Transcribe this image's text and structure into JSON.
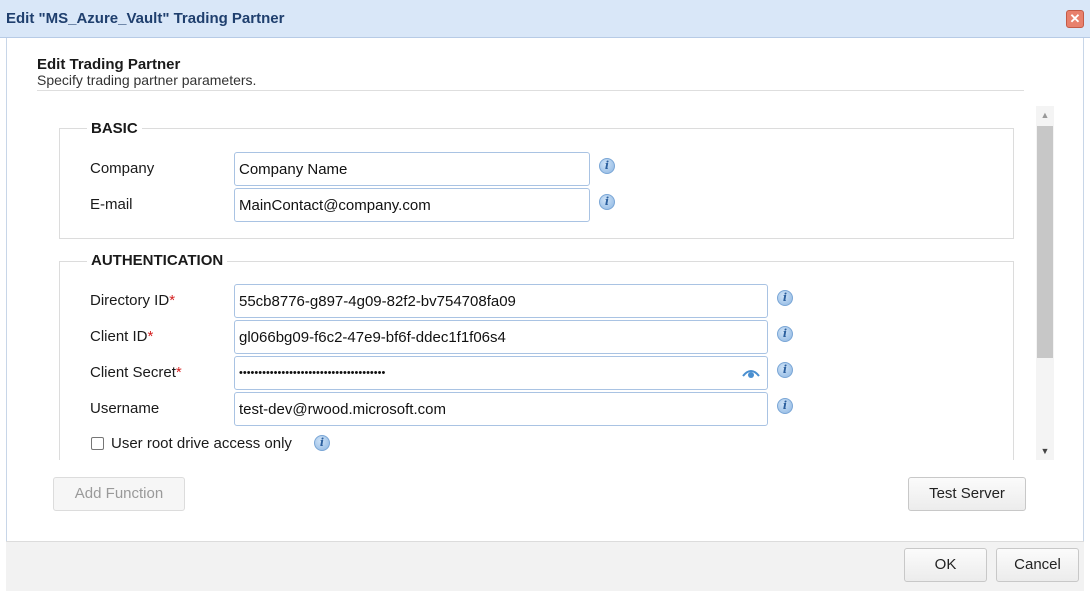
{
  "dialog": {
    "title": "Edit \"MS_Azure_Vault\" Trading Partner",
    "close_symbol": "✕"
  },
  "header": {
    "title": "Edit Trading Partner",
    "subtitle": "Specify trading partner parameters."
  },
  "basic": {
    "legend": "BASIC",
    "company_label": "Company",
    "company_value": "Company Name",
    "email_label": "E-mail",
    "email_value": "MainContact@company.com"
  },
  "authentication": {
    "legend": "AUTHENTICATION",
    "directory_id_label": "Directory ID",
    "directory_id_value": "55cb8776-g897-4g09-82f2-bv754708fa09",
    "client_id_label": "Client ID",
    "client_id_value": "gl066bg09-f6c2-47e9-bf6f-ddec1f1f06s4",
    "client_secret_label": "Client Secret",
    "client_secret_value": "••••••••••••••••••••••••••••••••••••••",
    "username_label": "Username",
    "username_value": "test-dev@rwood.microsoft.com",
    "root_drive_label": "User root drive access only",
    "required_mark": "*"
  },
  "actions": {
    "add_function": "Add Function",
    "test_server": "Test Server",
    "ok": "OK",
    "cancel": "Cancel"
  },
  "icons": {
    "info": "i",
    "scroll_up": "▲",
    "scroll_down": "▼"
  },
  "colors": {
    "titlebar": "#d9e7f8",
    "title_text": "#1f3f6e",
    "field_border": "#a9c3e3",
    "required": "#d42020",
    "close": "#e8806c"
  }
}
